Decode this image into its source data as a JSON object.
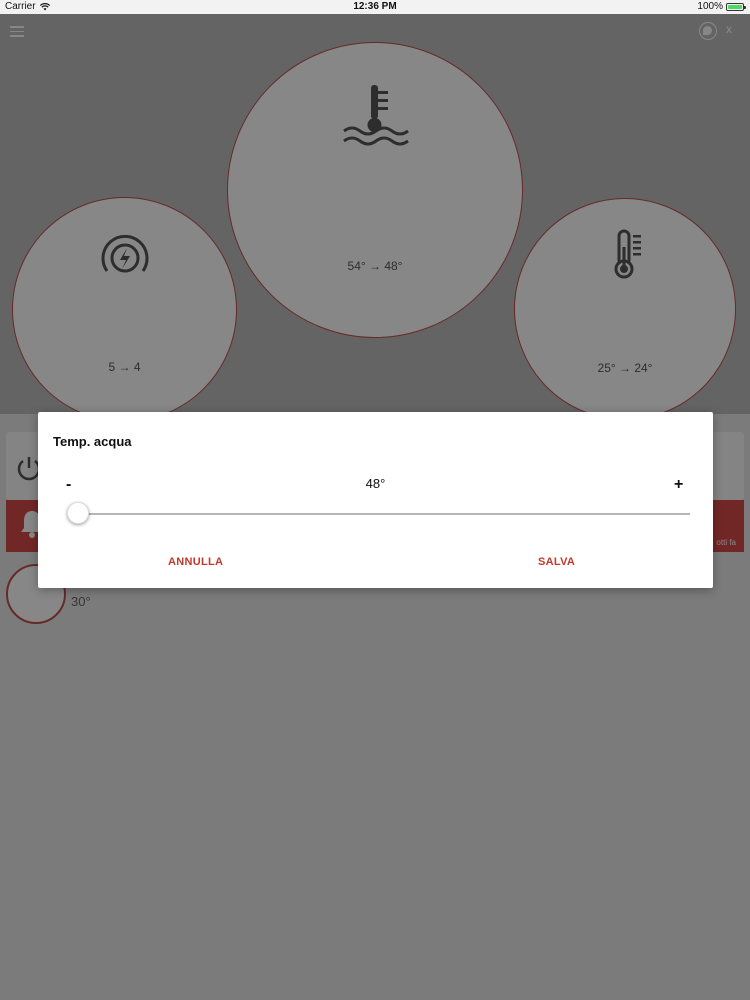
{
  "status_bar": {
    "carrier": "Carrier",
    "time": "12:36 PM",
    "battery": "100%"
  },
  "header": {
    "close_label": "x"
  },
  "gauges": {
    "power": {
      "text": "5 → 4",
      "icon": "power-gauge-icon"
    },
    "water": {
      "text": "54° → 48°",
      "icon": "water-temperature-icon"
    },
    "room": {
      "text": "25° → 24°",
      "icon": "thermometer-icon"
    }
  },
  "main": {
    "alarm_text": "otti fa",
    "mini_gauge_value": "30°"
  },
  "modal": {
    "title": "Temp. acqua",
    "minus_label": "-",
    "plus_label": "+",
    "value": "48°",
    "slider_level": 0.0,
    "cancel_label": "ANNULLA",
    "save_label": "SALVA"
  },
  "colors": {
    "accent": "#c0392b",
    "gauge_border": "#c0504d",
    "alarm": "#d84a4a"
  }
}
